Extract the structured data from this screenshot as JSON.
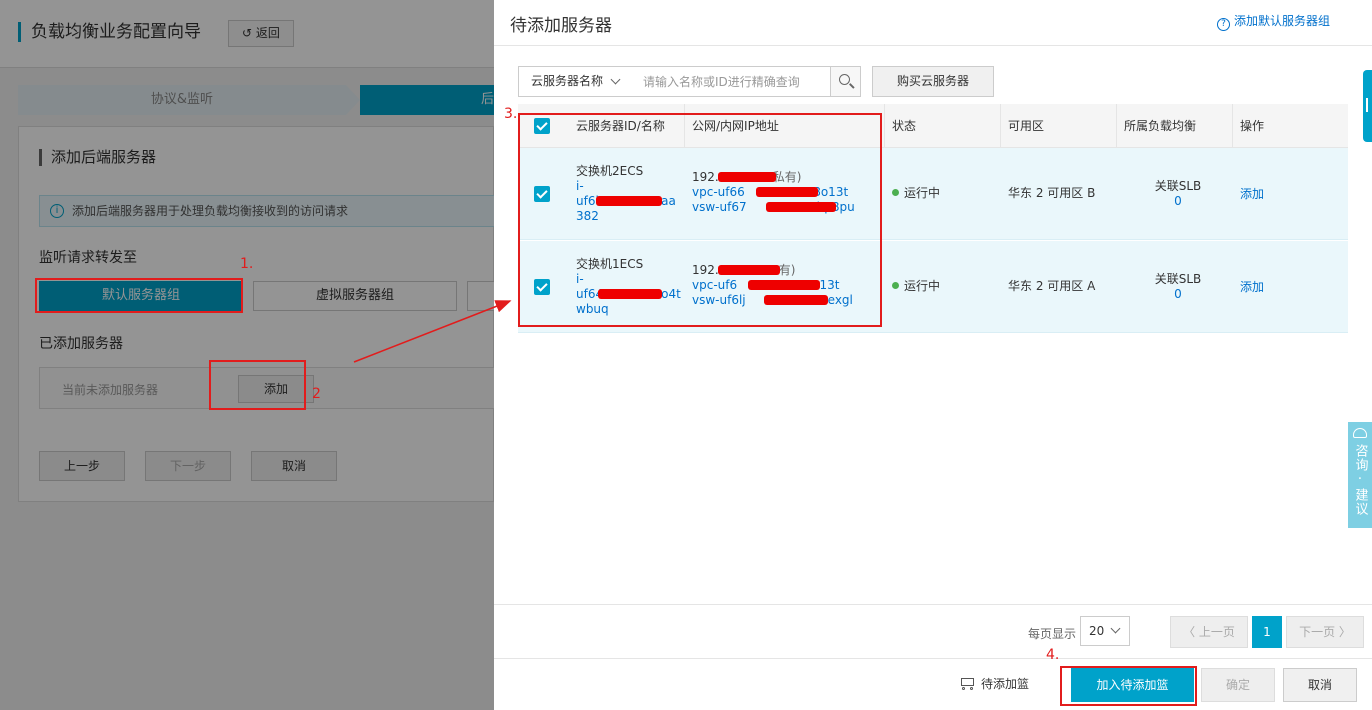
{
  "background_page": {
    "title": "负载均衡业务配置向导",
    "back_label": "返回",
    "steps": [
      "协议&监听",
      "后"
    ],
    "card_title": "添加后端服务器",
    "info_text": "添加后端服务器用于处理负载均衡接收到的访问请求",
    "forward_label": "监听请求转发至",
    "default_group_label": "默认服务器组",
    "virtual_group_label": "虚拟服务器组",
    "added_label": "已添加服务器",
    "none_added_text": "当前未添加服务器",
    "add_label": "添加",
    "prev_label": "上一步",
    "next_label": "下一步",
    "cancel_label": "取消"
  },
  "drawer": {
    "title": "待添加服务器",
    "default_group_link": "添加默认服务器组",
    "filter_label": "云服务器名称",
    "search_placeholder": "请输入名称或ID进行精确查询",
    "buy_label": "购买云服务器",
    "columns": [
      "云服务器ID/名称",
      "公网/内网IP地址",
      "状态",
      "可用区",
      "所属负载均衡",
      "操作"
    ],
    "rows": [
      {
        "name": "交换机2ECS",
        "id_lines": [
          "i-",
          "uf6b",
          "382"
        ],
        "id_tail_1": "aa",
        "ip_line1": "192.",
        "ip_note": "私有)",
        "vpc": "vpc-uf66",
        "vpc_tail": "xa8o13t",
        "vsw": "vsw-uf67",
        "vsw_tail": "bp8pu",
        "status": "运行中",
        "zone": "华东 2 可用区 B",
        "slb_label": "关联SLB",
        "slb_count": "0",
        "action": "添加"
      },
      {
        "name": "交换机1ECS",
        "id_lines": [
          "i-",
          "uf64",
          "wbuq"
        ],
        "id_tail_1": "o4t",
        "ip_line1": "192.",
        "ip_note": "有)",
        "vpc": "vpc-uf6",
        "vpc_tail": "a8o13t",
        "vsw": "vsw-uf6lj",
        "vsw_tail": "exgl",
        "status": "运行中",
        "zone": "华东 2 可用区 A",
        "slb_label": "关联SLB",
        "slb_count": "0",
        "action": "添加"
      }
    ],
    "pagination": {
      "per_page_label": "每页显示",
      "per_page_value": "20",
      "prev_label": "上一页",
      "current_page": "1",
      "next_label": "下一页"
    },
    "footer": {
      "basket_label": "待添加篮",
      "add_to_basket_label": "加入待添加篮",
      "confirm_label": "确定",
      "cancel_label": "取消"
    }
  },
  "side_widget": {
    "consult_label": "咨询·建议"
  },
  "annotations": {
    "num1": "1.",
    "num2": "2",
    "num3": "3.",
    "num4": "4."
  },
  "colors": {
    "accent": "#00a2ca",
    "link": "#0070cc",
    "annotation": "#e21c1c",
    "status_running": "#4caf50"
  }
}
